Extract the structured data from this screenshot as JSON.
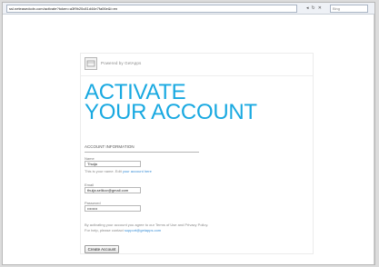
{
  "browser": {
    "url": "ssl.neteasedcdn.com/activate?token=a3f9b20c81d44e7fa06e&l=en",
    "nav_icons": [
      "back-icon",
      "refresh-icon",
      "stop-icon"
    ],
    "search_placeholder": "Bing"
  },
  "card": {
    "powered_by": "Powered by GetApps",
    "headline_line1": "ACTIVATE",
    "headline_line2": "YOUR ACCOUNT",
    "section_label": "ACCOUNT INFORMATION",
    "fields": [
      {
        "label": "Name",
        "value": "Thuija"
      },
      {
        "label": "Email",
        "value": "thuija.selikov@gmail.com"
      },
      {
        "label": "Password",
        "value": "••••••••"
      }
    ],
    "name_hint_prefix": "This is your name. Edit",
    "name_hint_link": "your account here",
    "notice_text": "By activating your account you agree to our Terms of Use and Privacy Policy.",
    "notice_text_2": "For help, please contact",
    "notice_link": "support@getapps.com",
    "button_label": "Create Account"
  },
  "colors": {
    "headline": "#19a9e1",
    "link": "#3a8fd6"
  }
}
